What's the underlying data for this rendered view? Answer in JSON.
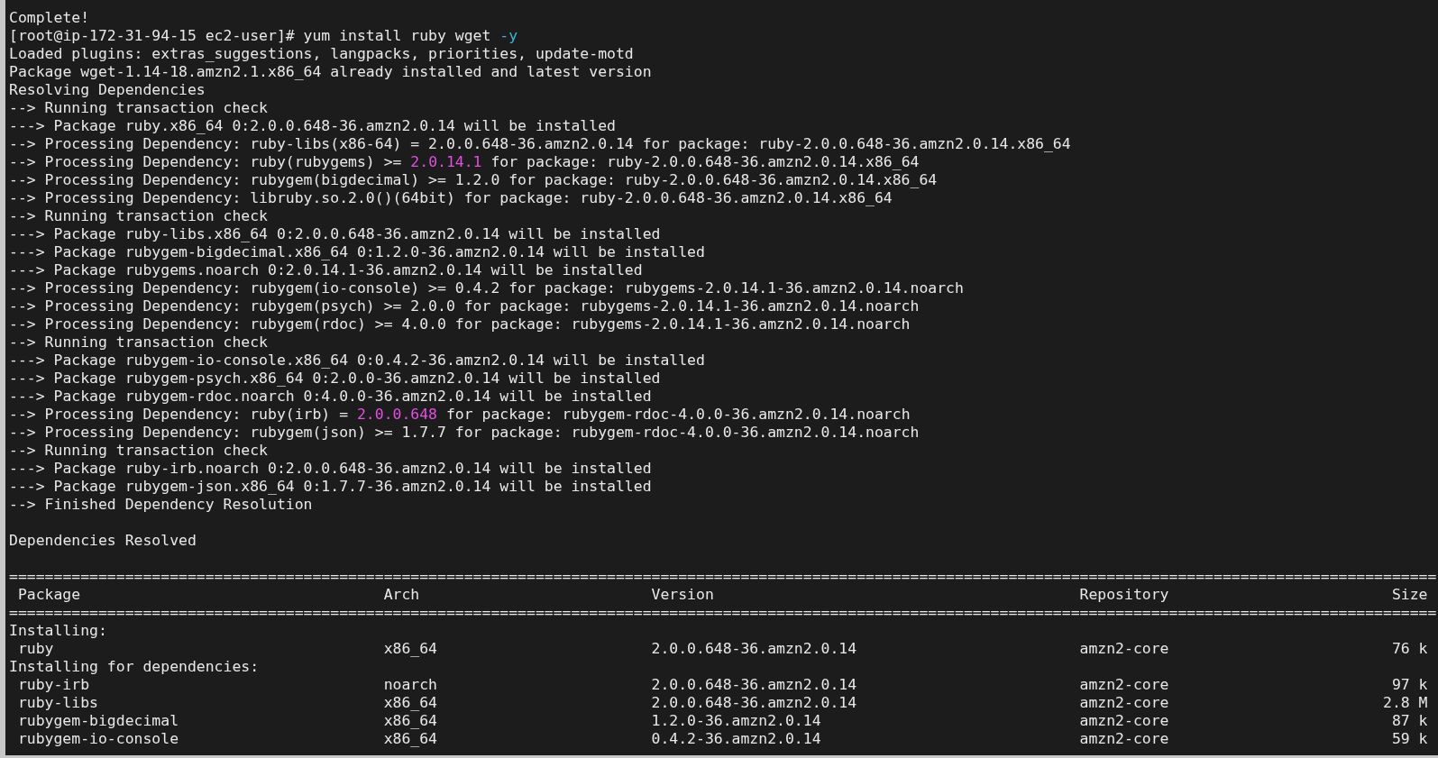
{
  "terminal": {
    "lines": [
      {
        "segments": [
          {
            "kind": "plain",
            "text": "Complete!"
          }
        ]
      },
      {
        "segments": [
          {
            "kind": "plain",
            "text": "[root@ip-172-31-94-15 ec2-user]# yum install ruby wget "
          },
          {
            "kind": "option",
            "text": "-y"
          }
        ]
      },
      {
        "segments": [
          {
            "kind": "plain",
            "text": "Loaded plugins: extras_suggestions, langpacks, priorities, update-motd"
          }
        ]
      },
      {
        "segments": [
          {
            "kind": "plain",
            "text": "Package wget-1.14-18.amzn2.1.x86_64 already installed and latest version"
          }
        ]
      },
      {
        "segments": [
          {
            "kind": "plain",
            "text": "Resolving Dependencies"
          }
        ]
      },
      {
        "segments": [
          {
            "kind": "plain",
            "text": "--> Running transaction check"
          }
        ]
      },
      {
        "segments": [
          {
            "kind": "plain",
            "text": "---> Package ruby.x86_64 0:2.0.0.648-36.amzn2.0.14 will be installed"
          }
        ]
      },
      {
        "segments": [
          {
            "kind": "plain",
            "text": "--> Processing Dependency: ruby-libs(x86-64) = 2.0.0.648-36.amzn2.0.14 for package: ruby-2.0.0.648-36.amzn2.0.14.x86_64"
          }
        ]
      },
      {
        "segments": [
          {
            "kind": "plain",
            "text": "--> Processing Dependency: ruby(rubygems) >= "
          },
          {
            "kind": "number",
            "text": "2.0.14.1"
          },
          {
            "kind": "plain",
            "text": " for package: ruby-2.0.0.648-36.amzn2.0.14.x86_64"
          }
        ]
      },
      {
        "segments": [
          {
            "kind": "plain",
            "text": "--> Processing Dependency: rubygem(bigdecimal) >= 1.2.0 for package: ruby-2.0.0.648-36.amzn2.0.14.x86_64"
          }
        ]
      },
      {
        "segments": [
          {
            "kind": "plain",
            "text": "--> Processing Dependency: libruby.so.2.0()(64bit) for package: ruby-2.0.0.648-36.amzn2.0.14.x86_64"
          }
        ]
      },
      {
        "segments": [
          {
            "kind": "plain",
            "text": "--> Running transaction check"
          }
        ]
      },
      {
        "segments": [
          {
            "kind": "plain",
            "text": "---> Package ruby-libs.x86_64 0:2.0.0.648-36.amzn2.0.14 will be installed"
          }
        ]
      },
      {
        "segments": [
          {
            "kind": "plain",
            "text": "---> Package rubygem-bigdecimal.x86_64 0:1.2.0-36.amzn2.0.14 will be installed"
          }
        ]
      },
      {
        "segments": [
          {
            "kind": "plain",
            "text": "---> Package rubygems.noarch 0:2.0.14.1-36.amzn2.0.14 will be installed"
          }
        ]
      },
      {
        "segments": [
          {
            "kind": "plain",
            "text": "--> Processing Dependency: rubygem(io-console) >= 0.4.2 for package: rubygems-2.0.14.1-36.amzn2.0.14.noarch"
          }
        ]
      },
      {
        "segments": [
          {
            "kind": "plain",
            "text": "--> Processing Dependency: rubygem(psych) >= 2.0.0 for package: rubygems-2.0.14.1-36.amzn2.0.14.noarch"
          }
        ]
      },
      {
        "segments": [
          {
            "kind": "plain",
            "text": "--> Processing Dependency: rubygem(rdoc) >= 4.0.0 for package: rubygems-2.0.14.1-36.amzn2.0.14.noarch"
          }
        ]
      },
      {
        "segments": [
          {
            "kind": "plain",
            "text": "--> Running transaction check"
          }
        ]
      },
      {
        "segments": [
          {
            "kind": "plain",
            "text": "---> Package rubygem-io-console.x86_64 0:0.4.2-36.amzn2.0.14 will be installed"
          }
        ]
      },
      {
        "segments": [
          {
            "kind": "plain",
            "text": "---> Package rubygem-psych.x86_64 0:2.0.0-36.amzn2.0.14 will be installed"
          }
        ]
      },
      {
        "segments": [
          {
            "kind": "plain",
            "text": "---> Package rubygem-rdoc.noarch 0:4.0.0-36.amzn2.0.14 will be installed"
          }
        ]
      },
      {
        "segments": [
          {
            "kind": "plain",
            "text": "--> Processing Dependency: ruby(irb) = "
          },
          {
            "kind": "number",
            "text": "2.0.0.648"
          },
          {
            "kind": "plain",
            "text": " for package: rubygem-rdoc-4.0.0-36.amzn2.0.14.noarch"
          }
        ]
      },
      {
        "segments": [
          {
            "kind": "plain",
            "text": "--> Processing Dependency: rubygem(json) >= 1.7.7 for package: rubygem-rdoc-4.0.0-36.amzn2.0.14.noarch"
          }
        ]
      },
      {
        "segments": [
          {
            "kind": "plain",
            "text": "--> Running transaction check"
          }
        ]
      },
      {
        "segments": [
          {
            "kind": "plain",
            "text": "---> Package ruby-irb.noarch 0:2.0.0.648-36.amzn2.0.14 will be installed"
          }
        ]
      },
      {
        "segments": [
          {
            "kind": "plain",
            "text": "---> Package rubygem-json.x86_64 0:1.7.7-36.amzn2.0.14 will be installed"
          }
        ]
      },
      {
        "segments": [
          {
            "kind": "plain",
            "text": "--> Finished Dependency Resolution"
          }
        ]
      },
      {
        "kind": "blank"
      },
      {
        "segments": [
          {
            "kind": "plain",
            "text": "Dependencies Resolved"
          }
        ]
      },
      {
        "kind": "blank"
      }
    ],
    "table": {
      "rule": "================================================================================================================================================================",
      "columns": [
        "Package",
        "Arch",
        "Version",
        "Repository",
        "Size"
      ],
      "rows": [
        {
          "kind": "group",
          "text": "Installing:"
        },
        {
          "kind": "package",
          "cells": [
            "ruby",
            "x86_64",
            "2.0.0.648-36.amzn2.0.14",
            "amzn2-core",
            "76 k"
          ]
        },
        {
          "kind": "group",
          "text": "Installing for dependencies:"
        },
        {
          "kind": "package",
          "cells": [
            "ruby-irb",
            "noarch",
            "2.0.0.648-36.amzn2.0.14",
            "amzn2-core",
            "97 k"
          ]
        },
        {
          "kind": "package",
          "cells": [
            "ruby-libs",
            "x86_64",
            "2.0.0.648-36.amzn2.0.14",
            "amzn2-core",
            "2.8 M"
          ]
        },
        {
          "kind": "package",
          "cells": [
            "rubygem-bigdecimal",
            "x86_64",
            "1.2.0-36.amzn2.0.14",
            "amzn2-core",
            "87 k"
          ]
        },
        {
          "kind": "package",
          "cells": [
            "rubygem-io-console",
            "x86_64",
            "0.4.2-36.amzn2.0.14",
            "amzn2-core",
            "59 k"
          ]
        }
      ]
    }
  }
}
